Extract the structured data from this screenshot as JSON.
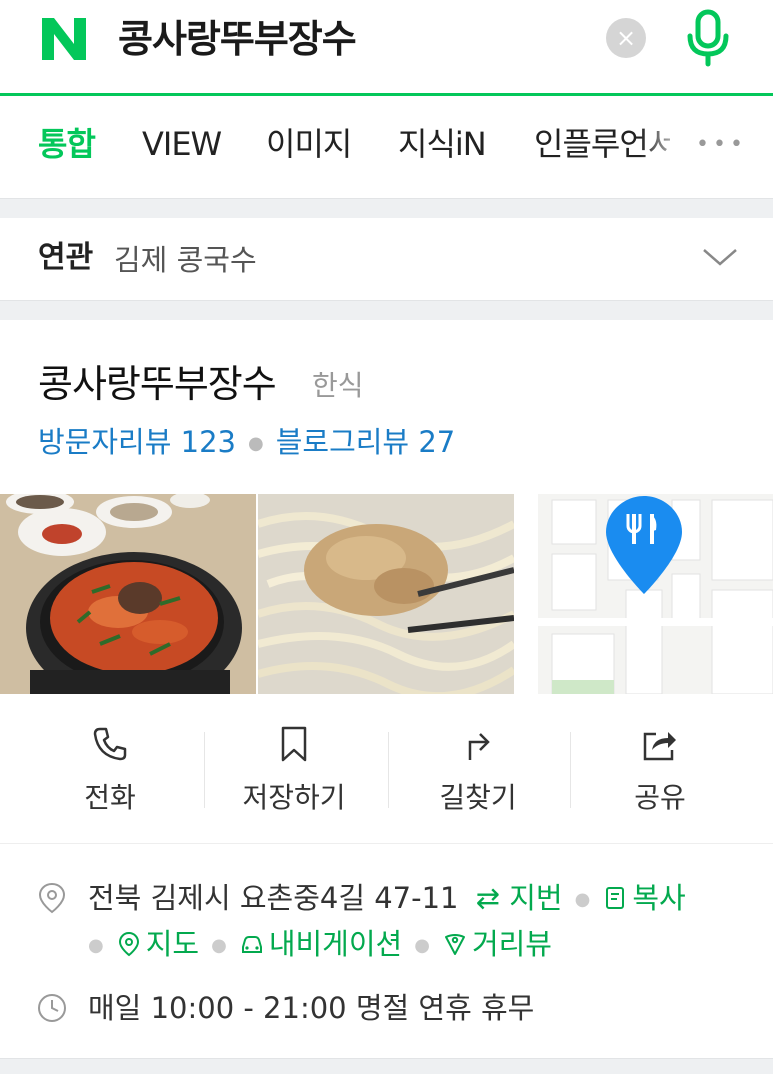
{
  "search": {
    "query": "콩사랑뚜부장수",
    "clear_symbol": "×"
  },
  "tabs": [
    {
      "label": "통합",
      "active": true
    },
    {
      "label": "VIEW",
      "active": false
    },
    {
      "label": "이미지",
      "active": false
    },
    {
      "label": "지식iN",
      "active": false
    },
    {
      "label": "인플루언서",
      "active": false
    }
  ],
  "tabs_more": "•••",
  "related": {
    "label": "연관",
    "item": "김제 콩국수"
  },
  "place": {
    "name": "콩사랑뚜부장수",
    "category": "한식",
    "visitor_reviews": "방문자리뷰 123",
    "blog_reviews": "블로그리뷰 27"
  },
  "actions": [
    {
      "label": "전화",
      "icon": "phone-icon"
    },
    {
      "label": "저장하기",
      "icon": "bookmark-icon"
    },
    {
      "label": "길찾기",
      "icon": "directions-icon"
    },
    {
      "label": "공유",
      "icon": "share-icon"
    }
  ],
  "info": {
    "address": "전북 김제시 요촌중4길 47-11",
    "lot_number_link": "지번",
    "copy_link": "복사",
    "map_link": "지도",
    "navigation_link": "내비게이션",
    "street_view_link": "거리뷰",
    "hours": "매일 10:00 - 21:00 명절 연휴 휴무"
  },
  "colors": {
    "brand_green": "#03c75a",
    "link_blue": "#1a7cc6",
    "map_pin_blue": "#1a8cf0"
  }
}
